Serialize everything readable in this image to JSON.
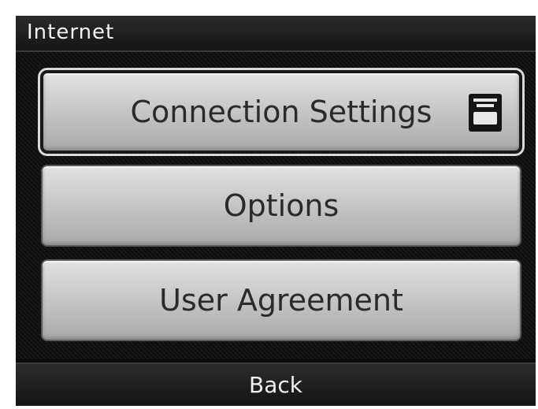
{
  "header": {
    "title": "Internet"
  },
  "menu": {
    "items": [
      {
        "label": "Connection Settings",
        "selected": true,
        "icon": "connection-settings-icon"
      },
      {
        "label": "Options",
        "selected": false
      },
      {
        "label": "User Agreement",
        "selected": false
      }
    ]
  },
  "footer": {
    "back_label": "Back"
  },
  "colors": {
    "button_face": "#c8c8c8",
    "screen_bg": "#0a0a0a",
    "text_dark": "#2a2a2a",
    "text_light": "#f2f2f2"
  }
}
